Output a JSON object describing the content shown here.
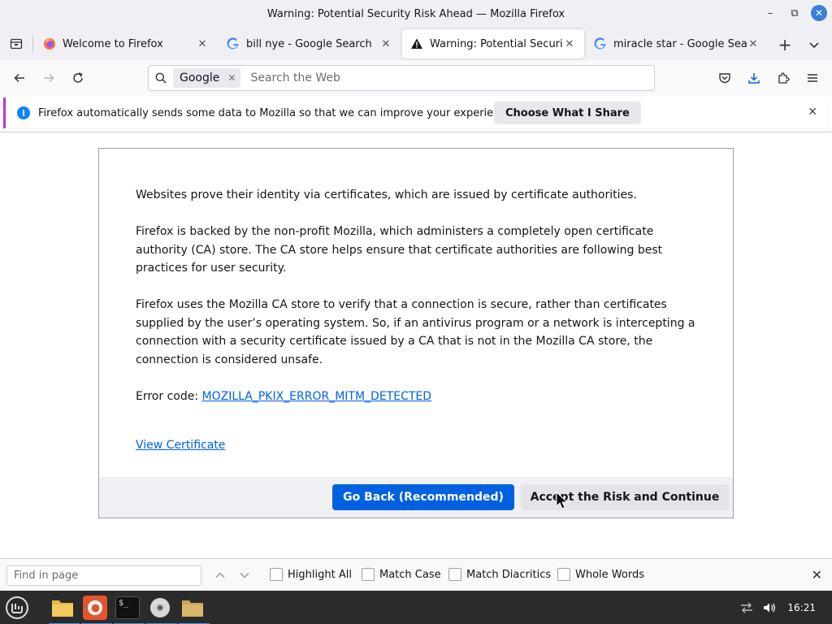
{
  "window": {
    "title": "Warning: Potential Security Risk Ahead — Mozilla Firefox"
  },
  "tabs": [
    {
      "label": "Welcome to Firefox",
      "icon": "firefox-icon",
      "active": false
    },
    {
      "label": "bill nye - Google Search",
      "icon": "google-icon",
      "active": false
    },
    {
      "label": "Warning: Potential Security Risk Ahead",
      "icon": "warning-icon",
      "active": true
    },
    {
      "label": "miracle star - Google Search",
      "icon": "google-icon",
      "active": false
    }
  ],
  "urlbar": {
    "engine": "Google",
    "placeholder": "Search the Web",
    "value": ""
  },
  "notification": {
    "text": "Firefox automatically sends some data to Mozilla so that we can improve your experience.",
    "button": "Choose What I Share"
  },
  "page": {
    "para1": "Websites prove their identity via certificates, which are issued by certificate authorities.",
    "para2": "Firefox is backed by the non-profit Mozilla, which administers a completely open certificate authority (CA) store. The CA store helps ensure that certificate authorities are following best practices for user security.",
    "para3": "Firefox uses the Mozilla CA store to verify that a connection is secure, rather than certificates supplied by the user’s operating system. So, if an antivirus program or a network is intercepting a connection with a security certificate issued by a CA that is not in the Mozilla CA store, the connection is considered unsafe.",
    "error_label": "Error code: ",
    "error_code": "MOZILLA_PKIX_ERROR_MITM_DETECTED",
    "view_certificate": "View Certificate",
    "go_back": "Go Back (Recommended)",
    "accept": "Accept the Risk and Continue"
  },
  "findbar": {
    "placeholder": "Find in page",
    "value": "",
    "options": [
      "Highlight All",
      "Match Case",
      "Match Diacritics",
      "Whole Words"
    ]
  },
  "taskbar": {
    "clock": "16:21"
  },
  "colors": {
    "accent": "#0061e0",
    "notif_border": "#b833e1",
    "taskbar": "#2b2b2b"
  }
}
